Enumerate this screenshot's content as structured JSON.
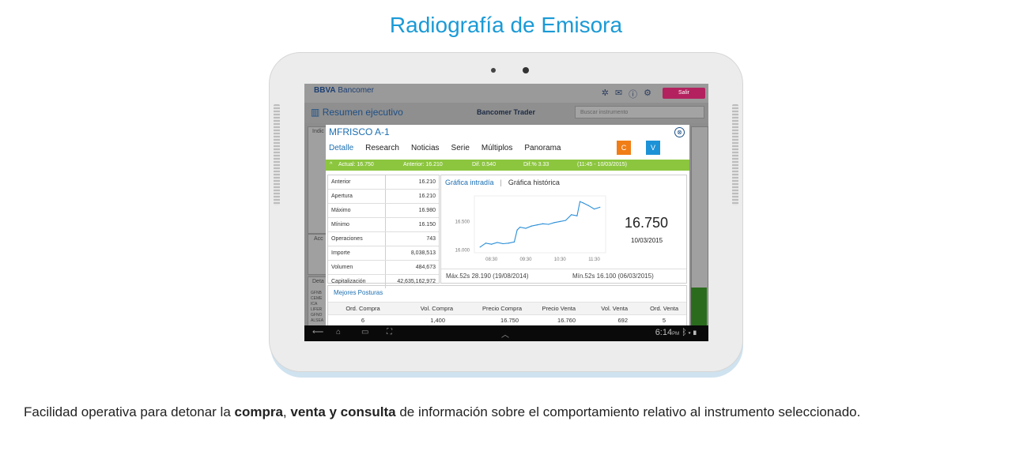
{
  "page": {
    "title": "Radiografía de Emisora",
    "caption_parts": [
      "Facilidad operativa para detonar la ",
      "compra",
      ", ",
      "venta y consulta",
      "  de información sobre el comportamiento relativo al instrumento seleccionado."
    ]
  },
  "app": {
    "logo_bold": "BBVA",
    "logo_rest": " Bancomer",
    "salir": "Salir",
    "section_title": "Resumen ejecutivo",
    "center_title": "Bancomer Trader",
    "search_placeholder": "Buscar instrumento",
    "bg_labels": {
      "ind": "Indic",
      "acc": "Acc",
      "det": "Deta",
      "list": [
        "GFNB",
        "CEME",
        "ICA",
        "LIFER",
        "GFNO",
        "ALSEA"
      ]
    }
  },
  "modal": {
    "title": "MFRISCO A-1",
    "close": "⊗",
    "tabs": [
      "Detalle",
      "Research",
      "Noticias",
      "Serie",
      "Múltiplos",
      "Panorama"
    ],
    "buy_label": "C",
    "sell_label": "V",
    "quote": {
      "arrow": "^",
      "actual": "Actual:  16.750",
      "anterior": "Anterior:  16.210",
      "dif": "Dif.   0.540",
      "difpct": "Dif.%   3.33",
      "time": "(11:45 - 10/03/2015)"
    },
    "stats": [
      {
        "label": "Anterior",
        "value": "16.210"
      },
      {
        "label": "Apertura",
        "value": "16.210"
      },
      {
        "label": "Máximo",
        "value": "16.980"
      },
      {
        "label": "Mínimo",
        "value": "16.150"
      },
      {
        "label": "Operaciones",
        "value": "743"
      },
      {
        "label": "Importe",
        "value": "8,038,513"
      },
      {
        "label": "Volumen",
        "value": "484,673"
      },
      {
        "label": "Capitalización",
        "value": "42,635,162,972"
      }
    ],
    "chart_tabs": [
      "Gráfica intradía",
      "|",
      "Gráfica histórica"
    ],
    "price": "16.750",
    "price_date": "10/03/2015",
    "max52": "Máx.52s  28.190  (19/08/2014)",
    "min52": "Mín.52s  16.100  (06/03/2015)",
    "posturas_title": "Mejores Posturas",
    "posturas_headers": [
      "Ord. Compra",
      "Vol. Compra",
      "Precio Compra",
      "Precio Venta",
      "Vol. Venta",
      "Ord. Venta"
    ],
    "posturas_row": [
      "6",
      "1,400",
      "16.750",
      "16.760",
      "692",
      "5"
    ]
  },
  "chart_data": {
    "type": "line",
    "title": "",
    "xlabel": "",
    "ylabel": "",
    "x_ticks": [
      "08:30",
      "09:30",
      "10:30",
      "11:30"
    ],
    "y_ticks": [
      "16.500",
      "16.000"
    ],
    "ylim": [
      15.95,
      16.95
    ],
    "x": [
      "08:10",
      "08:20",
      "08:30",
      "08:40",
      "08:50",
      "09:00",
      "09:10",
      "09:15",
      "09:20",
      "09:30",
      "09:40",
      "09:50",
      "10:00",
      "10:10",
      "10:20",
      "10:30",
      "10:40",
      "10:50",
      "11:00",
      "11:05",
      "11:10",
      "11:20",
      "11:30",
      "11:40"
    ],
    "values": [
      16.05,
      16.12,
      16.1,
      16.13,
      16.11,
      16.12,
      16.14,
      16.35,
      16.4,
      16.38,
      16.42,
      16.44,
      16.46,
      16.45,
      16.48,
      16.5,
      16.52,
      16.62,
      16.6,
      16.85,
      16.83,
      16.78,
      16.72,
      16.75
    ]
  },
  "navbar": {
    "time": "6:14",
    "ampm": "PM"
  }
}
